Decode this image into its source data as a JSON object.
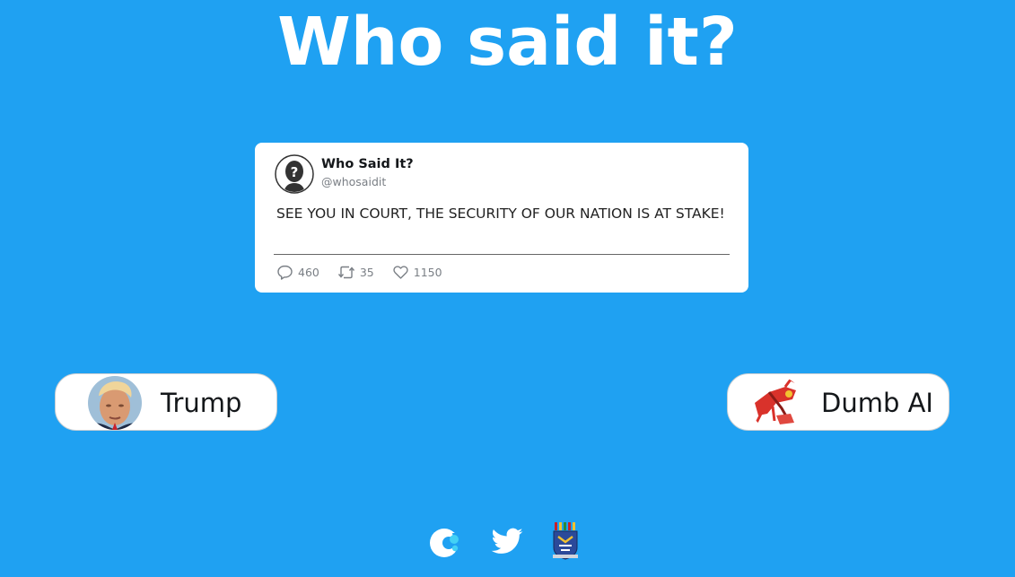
{
  "page": {
    "title": "Who said it?",
    "background_color": "#1fa1f2"
  },
  "tweet": {
    "account_name": "Who Said It?",
    "handle": "@whosaidit",
    "text": "SEE YOU IN COURT, THE SECURITY OF OUR NATION IS AT STAKE!",
    "avatar_icon": "question-mark-silhouette-icon",
    "stats": [
      {
        "icon": "reply-icon",
        "value": "460"
      },
      {
        "icon": "retweet-icon",
        "value": "35"
      },
      {
        "icon": "heart-icon",
        "value": "1150"
      }
    ]
  },
  "choices": [
    {
      "label": "Trump",
      "avatar": "trump-photo"
    },
    {
      "label": "Dumb AI",
      "avatar": "robot-drawing"
    }
  ],
  "footer": {
    "links": [
      {
        "icon": "app-logo-icon"
      },
      {
        "icon": "twitter-bird-icon"
      },
      {
        "icon": "university-crest-icon"
      }
    ]
  }
}
